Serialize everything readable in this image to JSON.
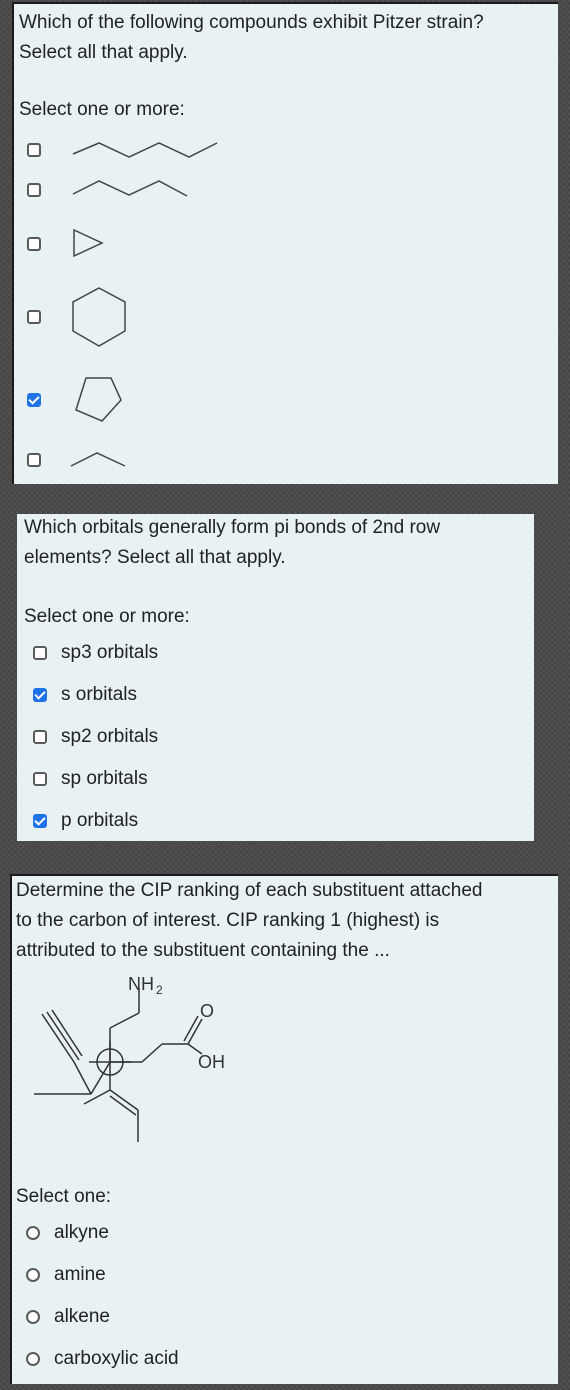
{
  "q1": {
    "text_line1": "Which of the following compounds exhibit Pitzer strain?",
    "text_line2": "Select all that apply.",
    "prompt": "Select one or more:",
    "options": [
      {
        "structure": "hexane-skeletal",
        "checked": false
      },
      {
        "structure": "pentane-skeletal",
        "checked": false
      },
      {
        "structure": "cyclopropane",
        "checked": false
      },
      {
        "structure": "cyclohexane",
        "checked": false
      },
      {
        "structure": "cyclopentane",
        "checked": true
      },
      {
        "structure": "propane-skeletal",
        "checked": false
      }
    ]
  },
  "q2": {
    "text_line1": "Which orbitals generally form pi bonds of 2nd row",
    "text_line2": "elements? Select all that apply.",
    "prompt": "Select one or more:",
    "options": [
      {
        "label": "sp3 orbitals",
        "checked": false
      },
      {
        "label": "s orbitals",
        "checked": true
      },
      {
        "label": "sp2 orbitals",
        "checked": false
      },
      {
        "label": "sp orbitals",
        "checked": false
      },
      {
        "label": "p orbitals",
        "checked": true
      }
    ]
  },
  "q3": {
    "text_line1": "Determine the CIP ranking of each substituent attached",
    "text_line2": "to the carbon of interest. CIP ranking 1 (highest) is",
    "text_line3": "attributed to the substituent containing the ...",
    "molecule_labels": {
      "nh2_main": "NH",
      "nh2_sub": "2",
      "oh": "OH",
      "o": "O"
    },
    "prompt": "Select one:",
    "options": [
      {
        "label": "alkyne",
        "selected": false
      },
      {
        "label": "amine",
        "selected": false
      },
      {
        "label": "alkene",
        "selected": false
      },
      {
        "label": "carboxylic acid",
        "selected": false
      }
    ]
  },
  "colors": {
    "card_bg": "#e8f1f4",
    "check_accent": "#1f73e8",
    "page_bg": "#4a4a4a"
  }
}
